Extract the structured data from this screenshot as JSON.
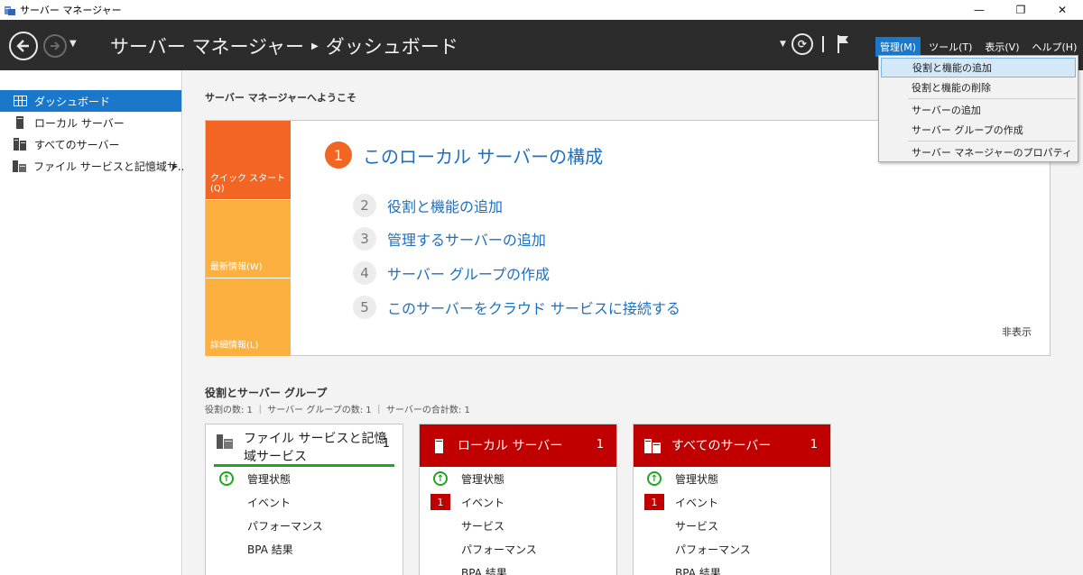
{
  "window": {
    "title": "サーバー マネージャー",
    "controls": [
      "—",
      "❐",
      "✕"
    ]
  },
  "header": {
    "breadcrumb_root": "サーバー マネージャー",
    "breadcrumb_current": "ダッシュボード",
    "menus": [
      "管理(M)",
      "ツール(T)",
      "表示(V)",
      "ヘルプ(H)"
    ],
    "active_menu": "管理(M)"
  },
  "manage_menu": {
    "items": [
      "役割と機能の追加",
      "役割と機能の削除",
      "サーバーの追加",
      "サーバー グループの作成",
      "サーバー マネージャーのプロパティ"
    ],
    "highlighted": "役割と機能の追加"
  },
  "sidebar": {
    "items": [
      {
        "label": "ダッシュボード",
        "icon": "dashboard-icon"
      },
      {
        "label": "ローカル サーバー",
        "icon": "server-icon"
      },
      {
        "label": "すべてのサーバー",
        "icon": "servers-icon"
      },
      {
        "label": "ファイル サービスと記憶域サ...",
        "icon": "file-services-icon"
      }
    ]
  },
  "welcome": {
    "title": "サーバー マネージャーへようこそ",
    "tiles": [
      "クイック スタート(Q)",
      "最新情報(W)",
      "詳細情報(L)"
    ],
    "steps": [
      {
        "num": "1",
        "label": "このローカル サーバーの構成"
      },
      {
        "num": "2",
        "label": "役割と機能の追加"
      },
      {
        "num": "3",
        "label": "管理するサーバーの追加"
      },
      {
        "num": "4",
        "label": "サーバー グループの作成"
      },
      {
        "num": "5",
        "label": "このサーバーをクラウド サービスに接続する"
      }
    ],
    "hide": "非表示"
  },
  "roles": {
    "title": "役割とサーバー グループ",
    "summary": "役割の数: 1 ｜ サーバー グループの数: 1 ｜ サーバーの合計数: 1",
    "cards": [
      {
        "name": "ファイル サービスと記憶域サービス",
        "count": "1",
        "rows": [
          {
            "badge": "ok",
            "label": "管理状態"
          },
          {
            "badge": "",
            "label": "イベント"
          },
          {
            "badge": "",
            "label": "パフォーマンス"
          },
          {
            "badge": "",
            "label": "BPA 結果"
          }
        ]
      },
      {
        "name": "ローカル サーバー",
        "count": "1",
        "rows": [
          {
            "badge": "ok",
            "label": "管理状態"
          },
          {
            "badge": "1",
            "label": "イベント"
          },
          {
            "badge": "",
            "label": "サービス"
          },
          {
            "badge": "",
            "label": "パフォーマンス"
          },
          {
            "badge": "",
            "label": "BPA 結果"
          }
        ]
      },
      {
        "name": "すべてのサーバー",
        "count": "1",
        "rows": [
          {
            "badge": "ok",
            "label": "管理状態"
          },
          {
            "badge": "1",
            "label": "イベント"
          },
          {
            "badge": "",
            "label": "サービス"
          },
          {
            "badge": "",
            "label": "パフォーマンス"
          },
          {
            "badge": "",
            "label": "BPA 結果"
          }
        ]
      }
    ]
  },
  "colors": {
    "header_bg": "#2c2c2c",
    "accent": "#1a77c9",
    "quick_start": "#f26522",
    "tile_amber": "#fbb040",
    "alert_red": "#c00000",
    "ok_green": "#1fa61f"
  }
}
